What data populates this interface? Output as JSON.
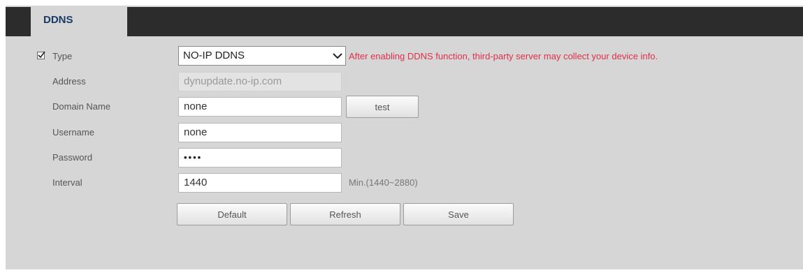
{
  "tab": {
    "label": "DDNS"
  },
  "form": {
    "type": {
      "enabled": true,
      "label": "Type",
      "selected": "NO-IP DDNS",
      "warning": "After enabling DDNS function, third-party server may collect your device info."
    },
    "address": {
      "label": "Address",
      "value": "dynupdate.no-ip.com"
    },
    "domain_name": {
      "label": "Domain Name",
      "value": "none",
      "test_label": "test"
    },
    "username": {
      "label": "Username",
      "value": "none"
    },
    "password": {
      "label": "Password",
      "value": "••••"
    },
    "interval": {
      "label": "Interval",
      "value": "1440",
      "hint": "Min.(1440~2880)"
    }
  },
  "buttons": {
    "default": "Default",
    "refresh": "Refresh",
    "save": "Save"
  },
  "colors": {
    "warning": "#e0304a",
    "tabbar": "#2c2c2c",
    "panel": "#d6d6d6"
  }
}
